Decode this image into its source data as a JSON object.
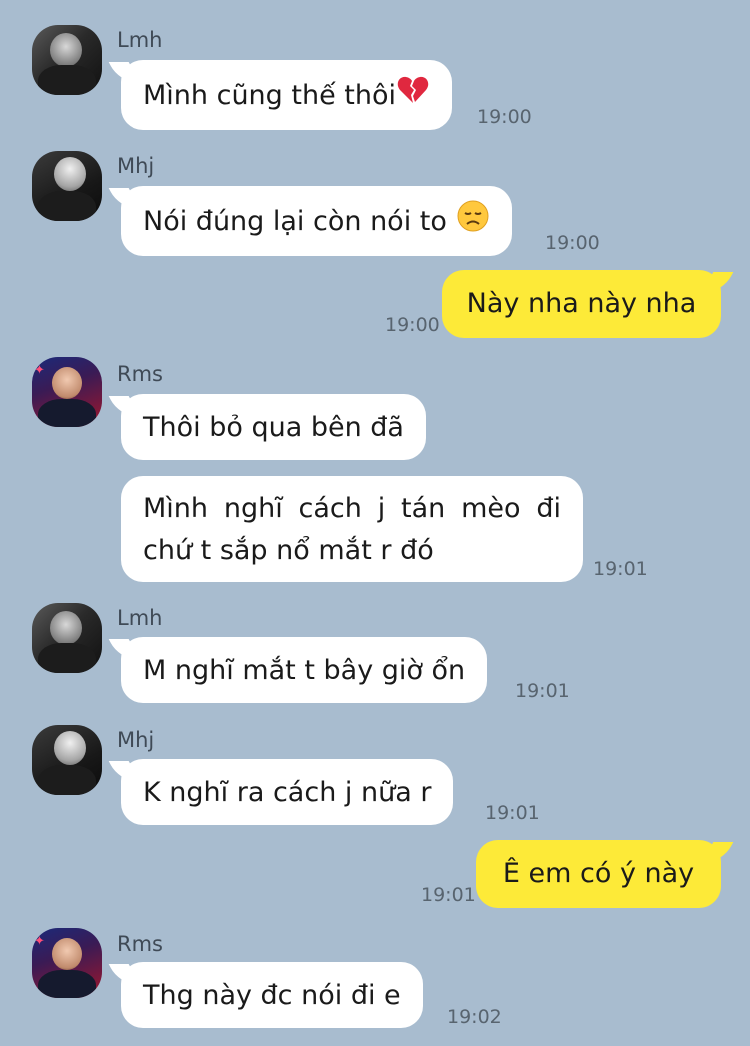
{
  "messages": [
    {
      "sender": "Lmh",
      "text": "Mình cũng thế thôi",
      "emoji": "broken-heart-icon",
      "time": "19:00"
    },
    {
      "sender": "Mhj",
      "text": "Nói đúng lại còn nói to",
      "emoji": "disappointed-face-icon",
      "time": "19:00"
    },
    {
      "sender": "me",
      "text": "Này nha này nha",
      "time": "19:00"
    },
    {
      "sender": "Rms",
      "text": "Thôi bỏ qua bên đã"
    },
    {
      "sender": "Rms",
      "text": "Mình nghĩ cách j tán mèo đi chứ t sắp nổ mắt r đó",
      "time": "19:01"
    },
    {
      "sender": "Lmh",
      "text": "M nghĩ mắt t bây giờ ổn",
      "time": "19:01"
    },
    {
      "sender": "Mhj",
      "text": "K nghĩ ra cách j nữa r",
      "time": "19:01"
    },
    {
      "sender": "me",
      "text": "Ê em có ý này",
      "time": "19:01"
    },
    {
      "sender": "Rms",
      "text": "Thg này đc nói đi e",
      "time": "19:02"
    }
  ],
  "colors": {
    "background": "#a8bccf",
    "incoming_bubble": "#ffffff",
    "outgoing_bubble": "#fdea38",
    "time_text": "#58646f"
  }
}
